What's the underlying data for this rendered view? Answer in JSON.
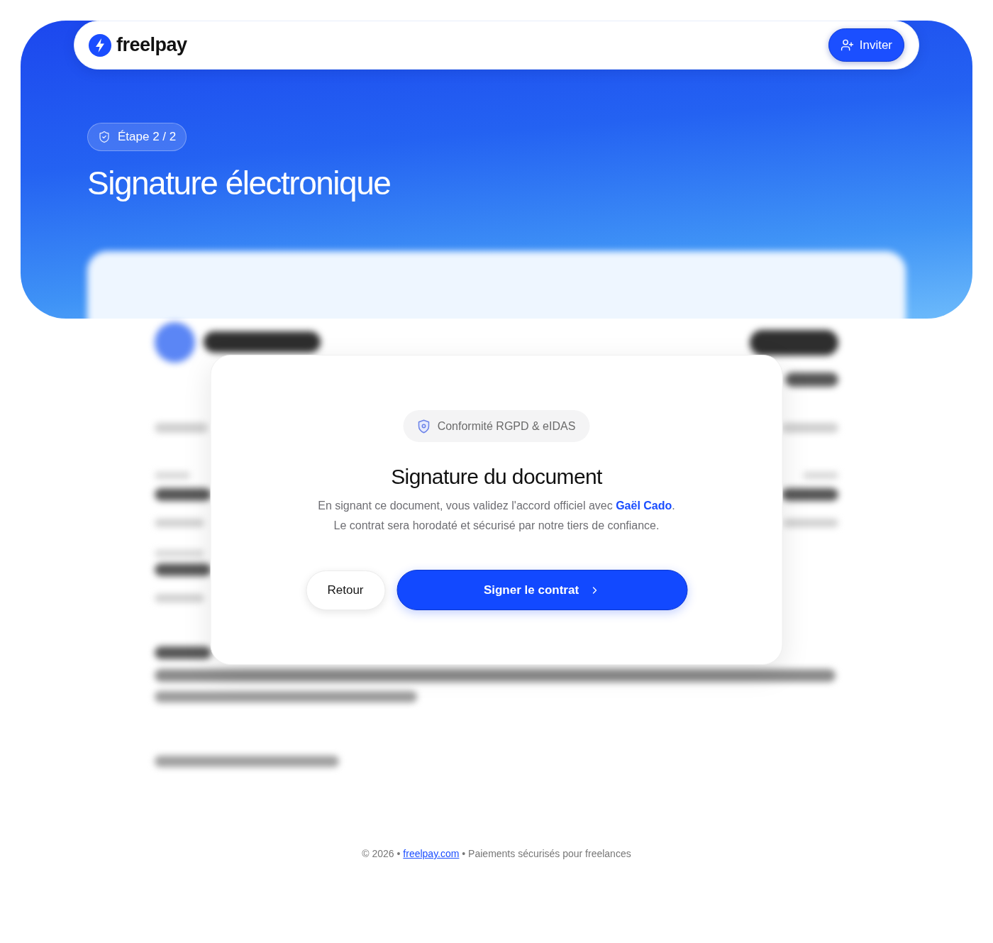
{
  "header": {
    "brand": "freelpay",
    "invite_button": "Inviter"
  },
  "hero": {
    "step_badge": "Étape 2 / 2",
    "title": "Signature électronique"
  },
  "dialog": {
    "badge": "Conformité RGPD & eIDAS",
    "title": "Signature du document",
    "consent": {
      "before": "En signant ce document, vous validez l'accord officiel avec ",
      "signer": "Gaël Cado",
      "after": "."
    },
    "note": "Le contrat sera horodaté et sécurisé par notre tiers de confiance.",
    "buttons": [
      {
        "label": "Retour",
        "kind": "secondary"
      },
      {
        "label": "Signer le contrat",
        "kind": "primary"
      }
    ]
  },
  "footer": {
    "before": "© 2026 • ",
    "link": "freelpay.com",
    "after": " • Paiements sécurisés pour freelances"
  }
}
